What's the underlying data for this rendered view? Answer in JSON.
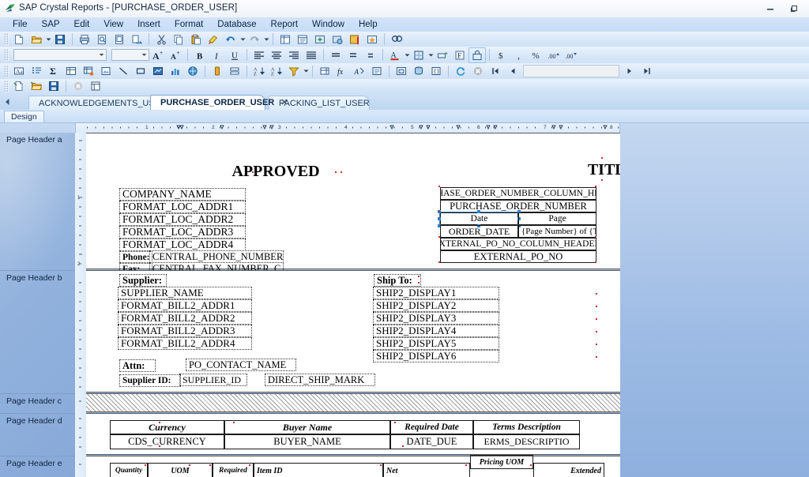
{
  "window": {
    "title": "SAP Crystal Reports - [PURCHASE_ORDER_USER]",
    "icon": "crystal-reports-icon",
    "minimize_label": "Minimize",
    "restore_label": "Restore",
    "controls": [
      "minimize",
      "restore"
    ]
  },
  "menu": {
    "items": [
      {
        "label": "File"
      },
      {
        "label": "SAP"
      },
      {
        "label": "Edit"
      },
      {
        "label": "View"
      },
      {
        "label": "Insert"
      },
      {
        "label": "Format"
      },
      {
        "label": "Database"
      },
      {
        "label": "Report"
      },
      {
        "label": "Window"
      },
      {
        "label": "Help"
      }
    ]
  },
  "toolbars": {
    "standard": {
      "buttons": [
        {
          "name": "new-report-icon",
          "title": "New"
        },
        {
          "name": "open-folder-icon",
          "title": "Open"
        },
        {
          "name": "open-dropdown-arrow",
          "title": "Open options"
        },
        {
          "name": "save-icon",
          "title": "Save"
        },
        {
          "name": "print-icon",
          "title": "Print"
        },
        {
          "name": "print-preview-icon",
          "title": "Print Preview"
        },
        {
          "name": "page-setup-icon",
          "title": "Page Setup"
        },
        {
          "name": "export-icon",
          "title": "Export"
        },
        {
          "name": "cut-icon",
          "title": "Cut"
        },
        {
          "name": "copy-icon",
          "title": "Copy"
        },
        {
          "name": "paste-icon",
          "title": "Paste"
        },
        {
          "name": "format-painter-icon",
          "title": "Format Painter"
        },
        {
          "name": "undo-icon",
          "title": "Undo"
        },
        {
          "name": "undo-dropdown-arrow",
          "title": "Undo history"
        },
        {
          "name": "redo-icon",
          "title": "Redo"
        },
        {
          "name": "redo-dropdown-arrow",
          "title": "Redo history"
        },
        {
          "name": "field-explorer-icon",
          "title": "Field Explorer"
        },
        {
          "name": "report-explorer-icon",
          "title": "Report Explorer"
        },
        {
          "name": "repository-explorer-icon",
          "title": "Repository Explorer"
        },
        {
          "name": "workbench-icon",
          "title": "Workbench"
        },
        {
          "name": "dependency-checker-icon",
          "title": "Dependency Checker"
        },
        {
          "name": "toolbox-icon",
          "title": "Toolbox"
        },
        {
          "name": "find-icon",
          "title": "Find"
        }
      ]
    },
    "formatting": {
      "font_name": {
        "value": "",
        "placeholder": ""
      },
      "font_size": {
        "value": "",
        "placeholder": ""
      },
      "buttons": [
        {
          "name": "increase-font-size-icon",
          "title": "Increase Font Size"
        },
        {
          "name": "decrease-font-size-icon",
          "title": "Decrease Font Size"
        },
        {
          "name": "bold-icon",
          "title": "Bold",
          "label": "B"
        },
        {
          "name": "italic-icon",
          "title": "Italic",
          "label": "I"
        },
        {
          "name": "underline-icon",
          "title": "Underline",
          "label": "U"
        },
        {
          "name": "align-left-icon",
          "title": "Align Left"
        },
        {
          "name": "align-center-icon",
          "title": "Align Center"
        },
        {
          "name": "align-right-icon",
          "title": "Align Right"
        },
        {
          "name": "justify-icon",
          "title": "Justify"
        },
        {
          "name": "line-spacing-1-icon",
          "title": "Single Spacing"
        },
        {
          "name": "line-spacing-15-icon",
          "title": "1.5 Spacing"
        },
        {
          "name": "line-spacing-2-icon",
          "title": "Double Spacing"
        },
        {
          "name": "font-color-icon",
          "title": "Font Color"
        },
        {
          "name": "font-color-dropdown-arrow",
          "title": "Font Color options"
        },
        {
          "name": "borders-icon",
          "title": "Borders"
        },
        {
          "name": "borders-dropdown-arrow",
          "title": "Border options"
        },
        {
          "name": "background-color-icon",
          "title": "Background Color"
        },
        {
          "name": "suppress-icon",
          "title": "Suppress"
        },
        {
          "name": "lock-size-position-icon",
          "title": "Lock Size and Position"
        },
        {
          "name": "currency-icon",
          "title": "Currency",
          "label": "$"
        },
        {
          "name": "thousands-separator-icon",
          "title": "Thousands Separator",
          "label": ","
        },
        {
          "name": "percent-icon",
          "title": "Percent",
          "label": "%"
        },
        {
          "name": "increase-decimals-icon",
          "title": "Increase Decimals"
        },
        {
          "name": "decrease-decimals-icon",
          "title": "Decrease Decimals"
        }
      ]
    },
    "insert_tools": {
      "buttons": [
        {
          "name": "insert-text-object-icon",
          "title": "Insert Text Object"
        },
        {
          "name": "insert-summary-icon",
          "title": "Insert Summary"
        },
        {
          "name": "insert-sum-icon",
          "title": "Insert Sum"
        },
        {
          "name": "insert-cross-tab-icon",
          "title": "Insert Cross-Tab"
        },
        {
          "name": "insert-olap-grid-icon",
          "title": "Insert OLAP Grid"
        },
        {
          "name": "insert-picture-icon",
          "title": "Insert Picture"
        },
        {
          "name": "insert-line-icon",
          "title": "Insert Line"
        },
        {
          "name": "insert-box-icon",
          "title": "Insert Box"
        },
        {
          "name": "insert-map-icon",
          "title": "Insert Map"
        },
        {
          "name": "insert-chart-icon",
          "title": "Insert Chart"
        },
        {
          "name": "insert-flash-icon",
          "title": "Insert Flash"
        },
        {
          "name": "highlighting-expert-icon",
          "title": "Highlighting Expert"
        },
        {
          "name": "group-expert-icon",
          "title": "Group Expert"
        },
        {
          "name": "sort-ascending-icon",
          "title": "Sort Ascending"
        },
        {
          "name": "record-sort-expert-icon",
          "title": "Record Sort Expert"
        },
        {
          "name": "select-expert-icon",
          "title": "Select Expert"
        },
        {
          "name": "select-expert-dropdown-arrow",
          "title": "Select Expert options"
        },
        {
          "name": "section-expert-icon",
          "title": "Section Expert"
        },
        {
          "name": "formula-workshop-icon",
          "title": "Formula Workshop",
          "label": "fx"
        },
        {
          "name": "formatting-formulas-icon",
          "title": "Formatting Formulas"
        },
        {
          "name": "report-alerts-icon",
          "title": "Report Alerts"
        },
        {
          "name": "insert-subreport-icon",
          "title": "Insert Subreport"
        },
        {
          "name": "database-expert-icon",
          "title": "Database Expert"
        },
        {
          "name": "parameter-icon",
          "title": "Parameter Fields"
        }
      ]
    },
    "navigation": {
      "buttons": [
        {
          "name": "refresh-icon",
          "title": "Refresh"
        },
        {
          "name": "stop-icon",
          "title": "Stop"
        },
        {
          "name": "first-page-icon",
          "title": "First Page"
        },
        {
          "name": "previous-page-icon",
          "title": "Previous Page"
        },
        {
          "name": "next-page-icon",
          "title": "Next Page"
        },
        {
          "name": "last-page-icon",
          "title": "Last Page"
        }
      ],
      "page_field": {
        "value": "",
        "placeholder": ""
      }
    },
    "file_row": {
      "buttons": [
        {
          "name": "new-document-icon",
          "title": "New"
        },
        {
          "name": "open-document-icon",
          "title": "Open"
        },
        {
          "name": "save-document-icon",
          "title": "Save"
        },
        {
          "name": "close-document-icon",
          "title": "Close"
        },
        {
          "name": "report-design-icon",
          "title": "Design"
        }
      ]
    }
  },
  "tabs": {
    "scroll_left_icon": "tab-scroll-left-icon",
    "items": [
      {
        "label": "ACKNOWLEDGEMENTS_USER",
        "active": false,
        "closable": false
      },
      {
        "label": "PURCHASE_ORDER_USER",
        "active": true,
        "closable": true,
        "close_label": "✕"
      },
      {
        "label": "PACKING_LIST_USER",
        "active": false,
        "closable": false
      }
    ]
  },
  "view_tabs": {
    "items": [
      {
        "label": "Design",
        "active": true
      }
    ]
  },
  "ruler": {
    "unit": "inches",
    "marks": [
      "1",
      "2",
      "3",
      "4",
      "5",
      "6",
      "7",
      "8"
    ]
  },
  "sections": [
    {
      "label": "Page Header a"
    },
    {
      "label": "Page Header b"
    },
    {
      "label": "Page Header c"
    },
    {
      "label": "Page Header d"
    },
    {
      "label": "Page Header e"
    }
  ],
  "report": {
    "header_a": {
      "approved_stamp": "APPROVED",
      "title_text": "TITLE",
      "company_name": "COMPANY_NAME",
      "loc_addr1": "FORMAT_LOC_ADDR1",
      "loc_addr2": "FORMAT_LOC_ADDR2",
      "loc_addr3": "FORMAT_LOC_ADDR3",
      "loc_addr4": "FORMAT_LOC_ADDR4",
      "phone_label": "Phone:",
      "phone_field": "CENTRAL_PHONE_NUMBER_C",
      "fax_label": "Fax:",
      "fax_field": "CENTRAL_FAX_NUMBER_C",
      "po_table": {
        "po_number_column_header": "HASE_ORDER_NUMBER_COLUMN_HE",
        "po_number_field": "PURCHASE_ORDER_NUMBER",
        "date_header": "Date",
        "page_header": "Page",
        "order_date_field": "ORDER_DATE",
        "page_number_field": "{Page Number} of {T",
        "external_po_column_header": "XTERNAL_PO_NO_COLUMN_HEADEI",
        "external_po_field": "EXTERNAL_PO_NO"
      },
      "selected_field": "Date"
    },
    "header_b": {
      "supplier_label": "Supplier:",
      "supplier_name": "SUPPLIER_NAME",
      "bill_addr1": "FORMAT_BILL2_ADDR1",
      "bill_addr2": "FORMAT_BILL2_ADDR2",
      "bill_addr3": "FORMAT_BILL2_ADDR3",
      "bill_addr4": "FORMAT_BILL2_ADDR4",
      "ship_to_label": "Ship To:",
      "ship_lines": [
        "SHIP2_DISPLAY1",
        "SHIP2_DISPLAY2",
        "SHIP2_DISPLAY3",
        "SHIP2_DISPLAY4",
        "SHIP2_DISPLAY5",
        "SHIP2_DISPLAY6"
      ],
      "attn_label": "Attn:",
      "attn_field": "PO_CONTACT_NAME",
      "supplier_id_label": "Supplier ID:",
      "supplier_id_field": "SUPPLIER_ID",
      "direct_ship_mark": "DIRECT_SHIP_MARK"
    },
    "header_c": {
      "suppressed": true
    },
    "header_d": {
      "columns": [
        {
          "header": "Currency",
          "value": "CDS_CURRENCY"
        },
        {
          "header": "Buyer Name",
          "value": "BUYER_NAME"
        },
        {
          "header": "Required Date",
          "value": "DATE_DUE"
        },
        {
          "header": "Terms Description",
          "value": "ERMS_DESCRIPTIO"
        }
      ]
    },
    "header_e": {
      "columns": [
        {
          "header": "Quantity"
        },
        {
          "header": "UOM"
        },
        {
          "header": "Required"
        },
        {
          "header": "Item ID"
        },
        {
          "header": "Net"
        },
        {
          "header": "Pricing UOM"
        },
        {
          "header": "Extended"
        }
      ]
    }
  },
  "colors": {
    "accent": "#2f7fd0",
    "selection_handle": "#2f7fd0",
    "guide_marker": "#cc2b2b",
    "canvas": "#ffffff",
    "backdrop": "#8fb0de"
  }
}
